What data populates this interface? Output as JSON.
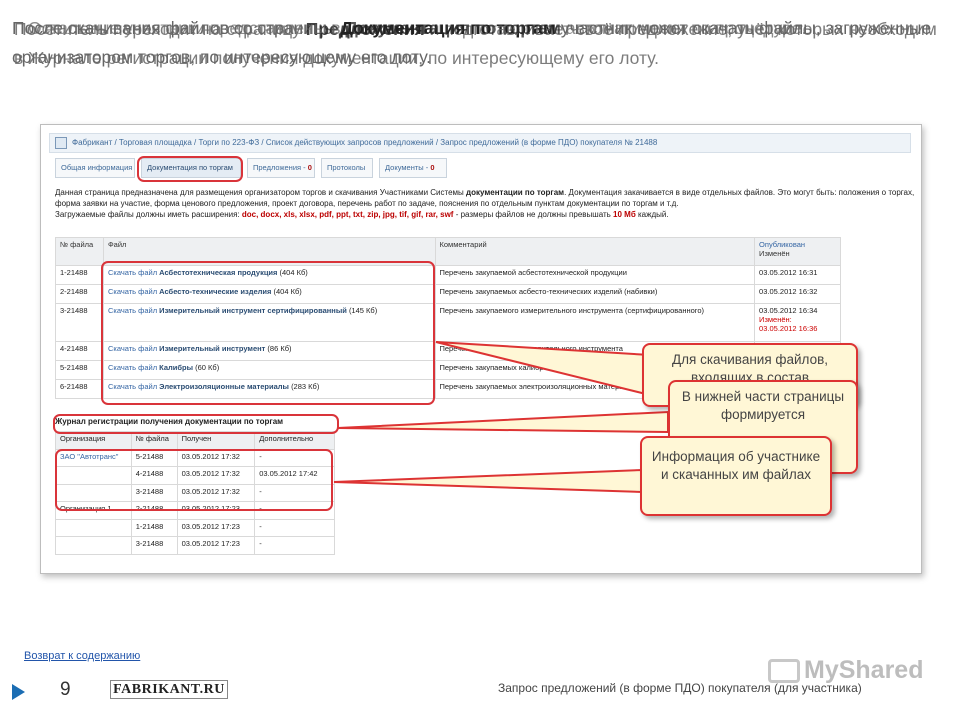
{
  "intro": {
    "layer1": {
      "before": "После скачивания файлов со страницы ",
      "bold": "Документация по торгам",
      "after": " участник может скачать файлы, загруженные организатором торгов, по интересующему его лоту."
    },
    "layer2": {
      "before": "Посетитель переходит на страницу ",
      "bold": "Предложения",
      "after": " и подготавливает своё предложение, учёт которых необходим в Журнале регистрации получения документации, по интересующему его лоту."
    },
    "layer3": {
      "before": "Остальные участники представлены в ",
      "bold": "Документация по торгам",
      "after": " автоматически по процедуре."
    }
  },
  "breadcrumb": "Фабрикант / Торговая площадка / Торги по 223-ФЗ / Список действующих запросов предложений / Запрос предложений (в форме ПДО) покупателя № 21488",
  "tabs": [
    {
      "label": "Общая информация",
      "count": ""
    },
    {
      "label": "Документация по торгам",
      "count": ""
    },
    {
      "label": "Предложения - ",
      "count": "0"
    },
    {
      "label": "Протоколы",
      "count": ""
    },
    {
      "label": "Документы - ",
      "count": "0"
    }
  ],
  "description": {
    "p1_before": "Данная страница предназначена для размещения организатором торгов и скачивания Участниками Системы ",
    "p1_bold": "документации по торгам",
    "p1_after": ". Документация закачивается в виде отдельных файлов. Это могут быть: положения о торгах, форма заявки на участие, форма ценового предложения, проект договора, перечень работ по задаче, пояснения по отдельным пунктам документации по торгам и т.д.",
    "p2_before": "Загружаемые файлы должны иметь расширения: ",
    "p2_ext": "doc, docx, xls, xlsx, pdf, ppt, txt, zip, jpg, tif, gif, rar, swf",
    "p2_mid": " - размеры файлов не должны превышать ",
    "p2_size": "10 Мб",
    "p2_after": " каждый."
  },
  "files_table": {
    "headers": [
      "№ файла",
      "Файл",
      "Комментарий"
    ],
    "header_pub": "Опубликован",
    "header_chg": "Изменён",
    "link_prefix": "Скачать файл ",
    "rows": [
      {
        "num": "1-21488",
        "name": "Асбестотехническая продукция",
        "size": "(404 Кб)",
        "comment": "Перечень закупаемой асбестотехнической продукции",
        "published": "03.05.2012 16:31",
        "changed_label": "",
        "changed": ""
      },
      {
        "num": "2-21488",
        "name": "Асбесто-технические изделия",
        "size": "(404 Кб)",
        "comment": "Перечень закупаемых асбесто-технических изделий (набивки)",
        "published": "03.05.2012 16:32",
        "changed_label": "",
        "changed": ""
      },
      {
        "num": "3-21488",
        "name": "Измерительный инструмент сертифицированный",
        "size": "(145 Кб)",
        "comment": "Перечень закупаемого измерительного инструмента (сертифицированного)",
        "published": "03.05.2012 16:34",
        "changed_label": "Изменён:",
        "changed": "03.05.2012 16:36"
      },
      {
        "num": "4-21488",
        "name": "Измерительный инструмент",
        "size": "(86 Кб)",
        "comment": "Перечень закупаемого измерительного инструмента",
        "published": "",
        "changed_label": "",
        "changed": ""
      },
      {
        "num": "5-21488",
        "name": "Калибры",
        "size": "(60 Кб)",
        "comment": "Перечень закупаемых калибров",
        "published": "",
        "changed_label": "",
        "changed": ""
      },
      {
        "num": "6-21488",
        "name": "Электроизоляционные материалы",
        "size": "(283 Кб)",
        "comment": "Перечень закупаемых электроизоляционных материалов",
        "published": "",
        "changed_label": "",
        "changed": ""
      }
    ]
  },
  "journal": {
    "title": "Журнал регистрации получения документации по торгам",
    "headers": [
      "Организация",
      "№ файла",
      "Получен",
      "Дополнительно"
    ],
    "rows": [
      {
        "org": "ЗАО \"Автотранс\"",
        "file": "5-21488",
        "received": "03.05.2012 17:32",
        "extra": "-"
      },
      {
        "org": "",
        "file": "4-21488",
        "received": "03.05.2012 17:32",
        "extra": "03.05.2012 17:42"
      },
      {
        "org": "",
        "file": "3-21488",
        "received": "03.05.2012 17:32",
        "extra": "-"
      },
      {
        "org": "Организация 1",
        "file": "2-21488",
        "received": "03.05.2012 17:23",
        "extra": "-"
      },
      {
        "org": "",
        "file": "1-21488",
        "received": "03.05.2012 17:23",
        "extra": "-"
      },
      {
        "org": "",
        "file": "3-21488",
        "received": "03.05.2012 17:23",
        "extra": "-"
      }
    ]
  },
  "callouts": {
    "c1": "Для скачивания файлов, входящих в состав",
    "c2": "В нижней части страницы формируется",
    "c3": "Информация об участнике и скачанных им файлах"
  },
  "footer": {
    "back_link": "Возврат к содержанию",
    "page_number": "9",
    "logo": "FABRIKANT.RU",
    "watermark": "MyShared",
    "caption": "Запрос предложений (в форме ПДО) покупателя (для участника)"
  },
  "colors": {
    "highlight": "#d9343a",
    "callout_bg": "#fff7d6",
    "link": "#3465a4"
  }
}
